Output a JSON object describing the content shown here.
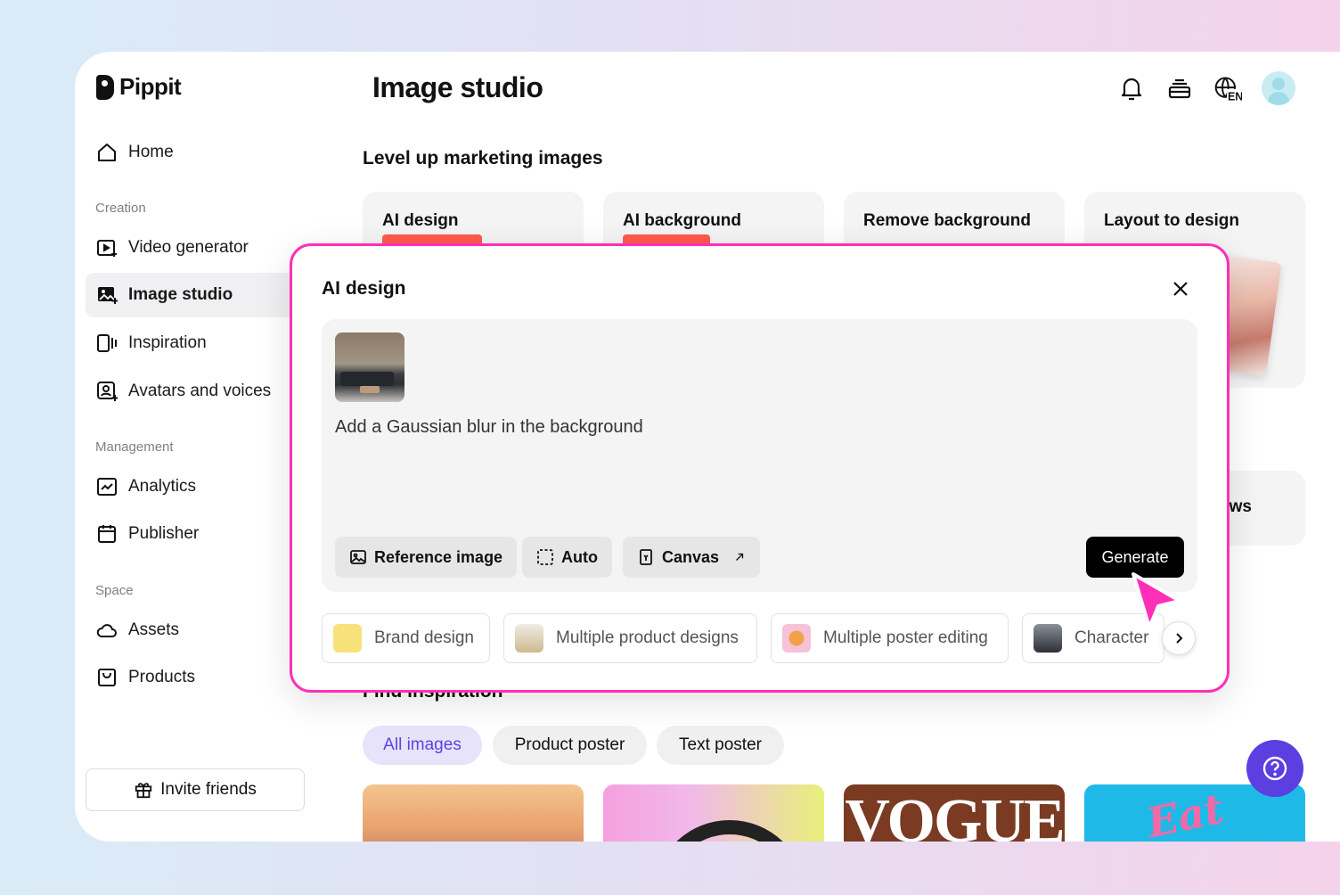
{
  "app": {
    "logo_text": "Pippit"
  },
  "sidebar": {
    "home": "Home",
    "sections": {
      "creation": "Creation",
      "management": "Management",
      "space": "Space"
    },
    "items": [
      {
        "label": "Video generator",
        "icon": "video-icon"
      },
      {
        "label": "Image studio",
        "icon": "image-icon",
        "active": true
      },
      {
        "label": "Inspiration",
        "icon": "inspiration-icon"
      },
      {
        "label": "Avatars and voices",
        "icon": "avatar-icon"
      },
      {
        "label": "Analytics",
        "icon": "chart-icon"
      },
      {
        "label": "Publisher",
        "icon": "calendar-icon"
      },
      {
        "label": "Assets",
        "icon": "cloud-icon"
      },
      {
        "label": "Products",
        "icon": "bag-icon"
      }
    ],
    "invite": "Invite friends"
  },
  "header": {
    "title": "Image studio",
    "language": "EN"
  },
  "main": {
    "section_heading": "Level up marketing images",
    "tool_cards": [
      "AI design",
      "AI background",
      "Remove background",
      "Layout to design"
    ],
    "partial_card_text": "ws",
    "find_heading": "Find inspiration",
    "filters": [
      "All images",
      "Product poster",
      "Text poster"
    ],
    "thumb_texts": {
      "vogue": "VOGUE",
      "eat": "Eat"
    }
  },
  "modal": {
    "title": "AI design",
    "prompt": "Add a Gaussian blur in the background",
    "options": {
      "reference": "Reference image",
      "auto": "Auto",
      "canvas": "Canvas"
    },
    "generate": "Generate",
    "presets": [
      "Brand design",
      "Multiple product designs",
      "Multiple poster editing",
      "Character"
    ]
  },
  "colors": {
    "accent_pink": "#ff2fb7",
    "accent_purple": "#5b3fe0",
    "generate_bg": "#000000"
  }
}
